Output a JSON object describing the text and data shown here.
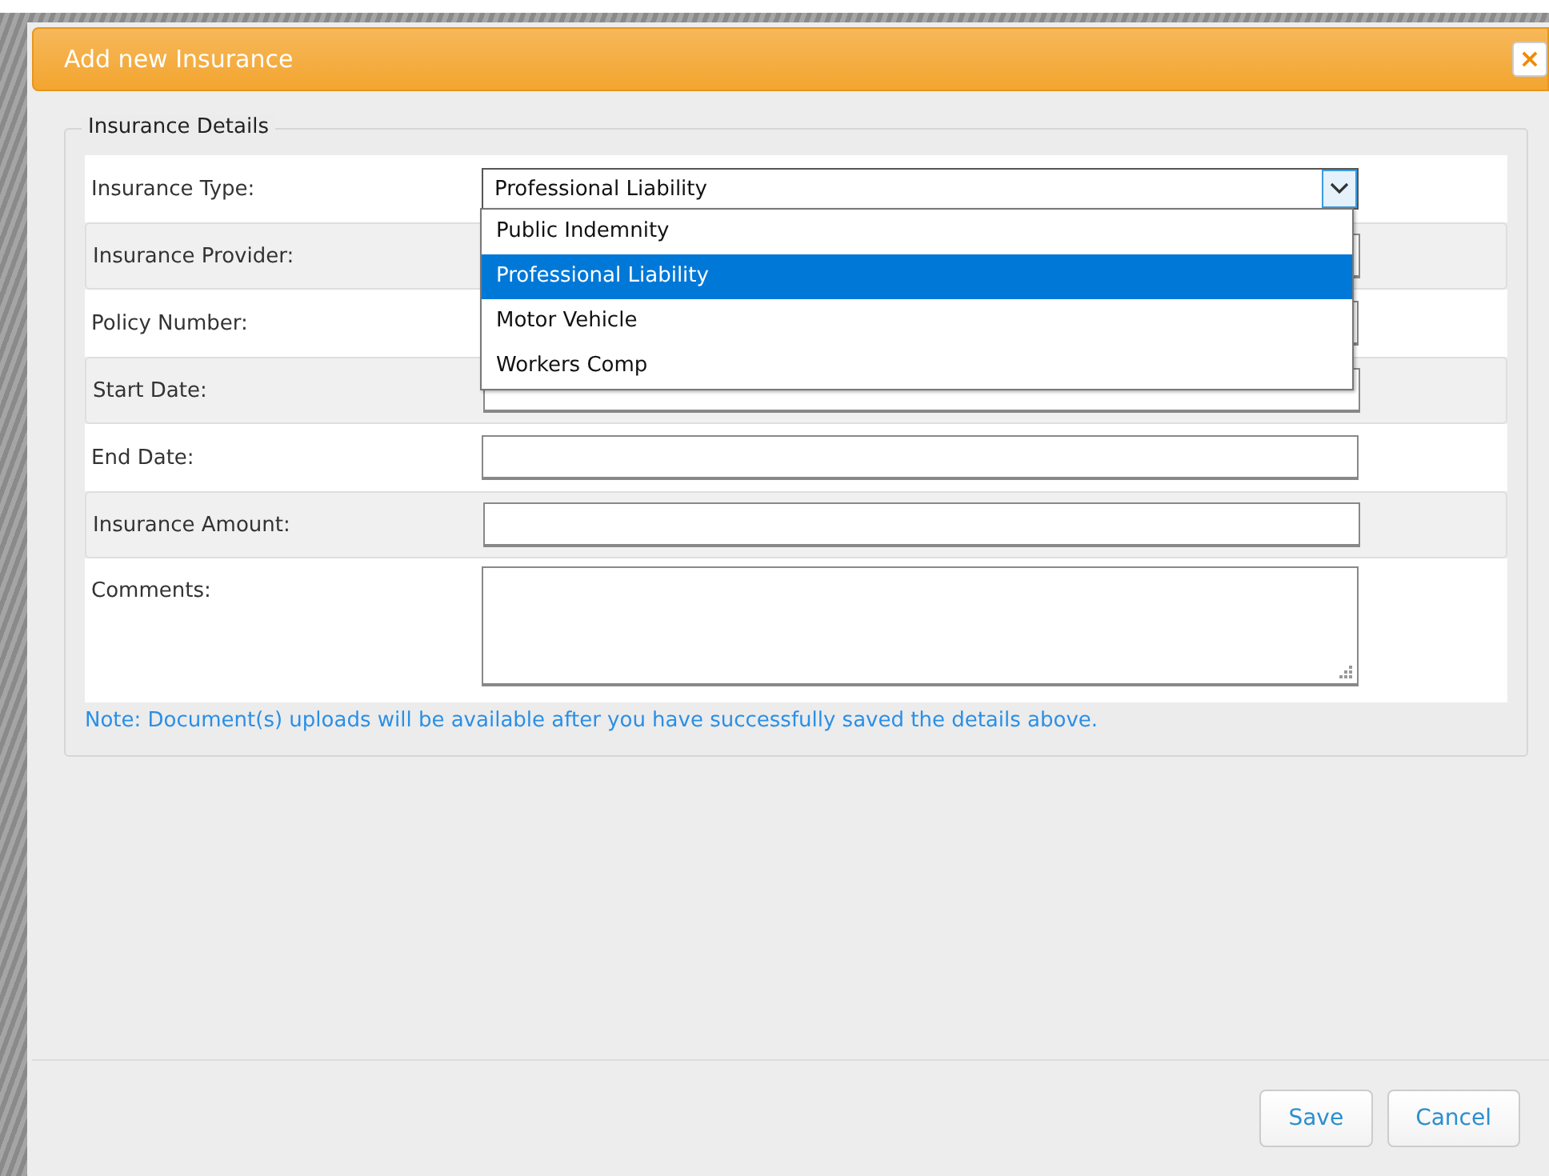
{
  "dialog": {
    "title": "Add new Insurance",
    "close": "×"
  },
  "section": {
    "legend": "Insurance Details"
  },
  "fields": [
    {
      "label": "Insurance Type:",
      "kind": "select",
      "value": "Professional Liability",
      "expanded": true
    },
    {
      "label": "Insurance Provider:",
      "kind": "text"
    },
    {
      "label": "Policy Number:",
      "kind": "text"
    },
    {
      "label": "Start Date:",
      "kind": "text"
    },
    {
      "label": "End Date:",
      "kind": "text"
    },
    {
      "label": "Insurance Amount:",
      "kind": "text"
    },
    {
      "label": "Comments:",
      "kind": "textarea"
    }
  ],
  "options": [
    {
      "label": "Public Indemnity",
      "selected": false
    },
    {
      "label": "Professional Liability",
      "selected": true
    },
    {
      "label": "Motor Vehicle",
      "selected": false
    },
    {
      "label": "Workers Comp",
      "selected": false
    }
  ],
  "note": "Note: Document(s) uploads will be available after you have successfully saved the details above.",
  "buttons": [
    "Save",
    "Cancel"
  ]
}
